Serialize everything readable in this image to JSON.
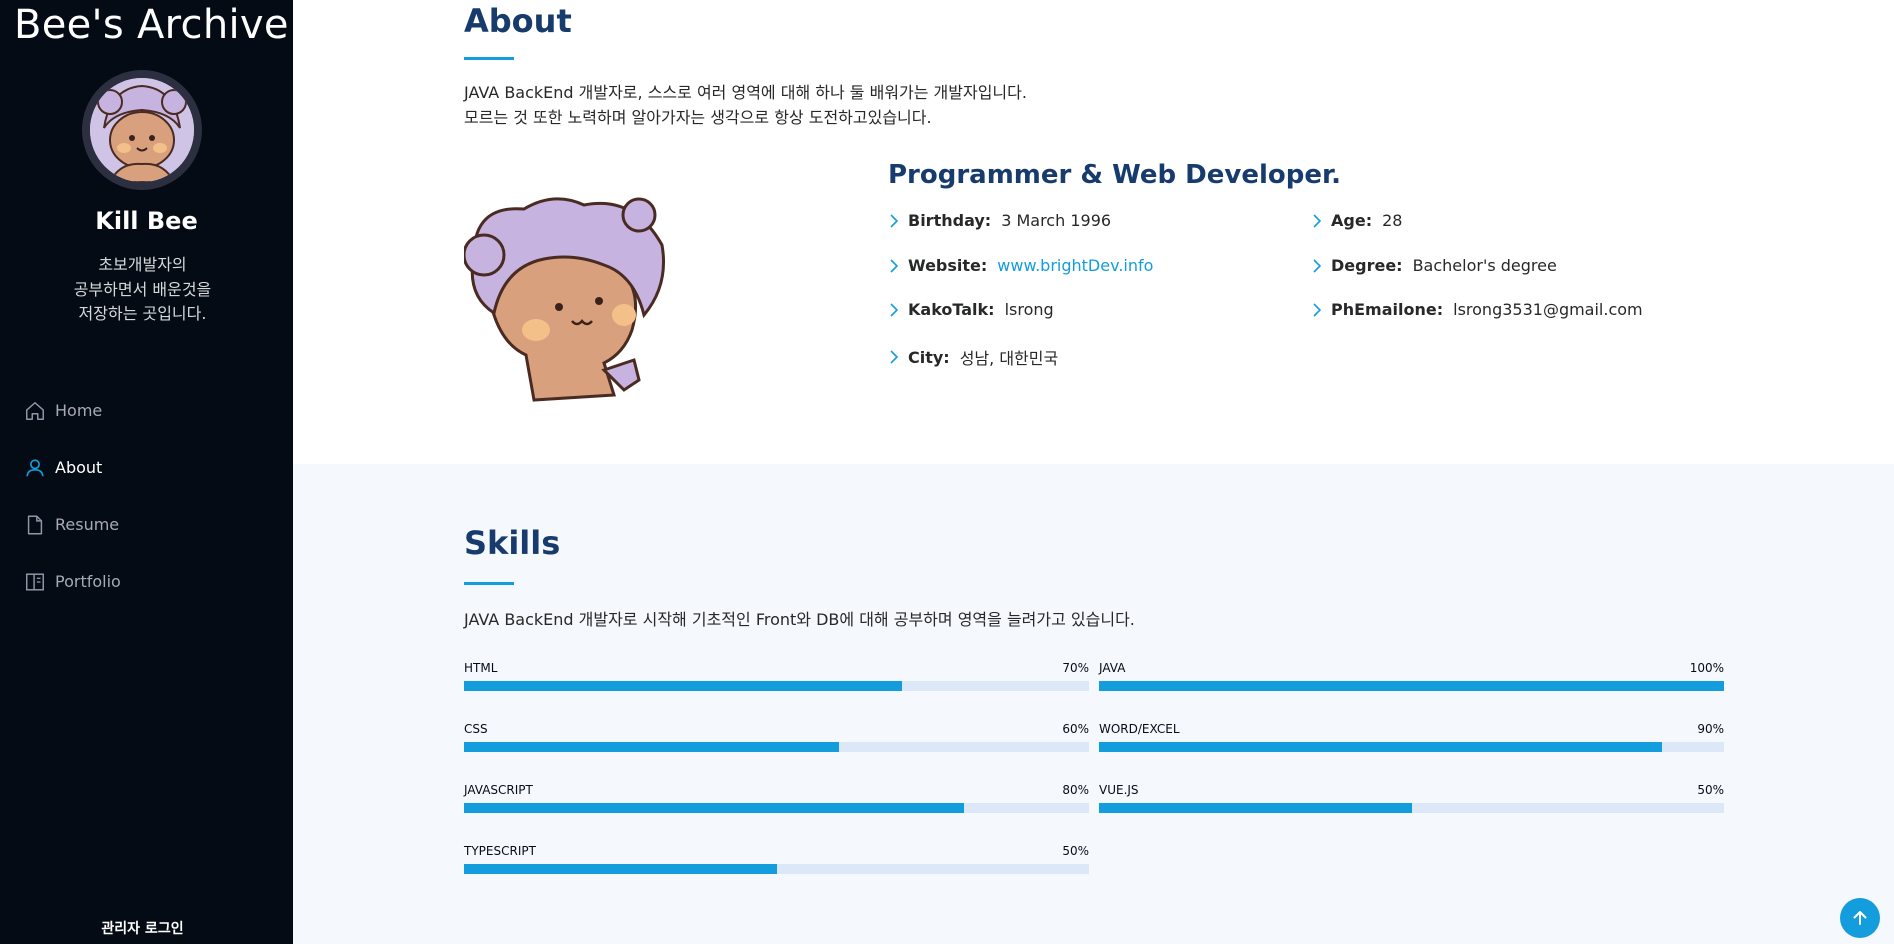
{
  "sidebar": {
    "site_title": "Bee's Archive",
    "profile_name": "Kill Bee",
    "profile_desc": "초보개발자의\n공부하면서 배운것을\n저장하는 곳입니다.",
    "nav": [
      {
        "label": "Home",
        "icon": "home-icon",
        "active": false
      },
      {
        "label": "About",
        "icon": "person-icon",
        "active": true
      },
      {
        "label": "Resume",
        "icon": "file-icon",
        "active": false
      },
      {
        "label": "Portfolio",
        "icon": "book-icon",
        "active": false
      }
    ],
    "admin_login": "관리자 로그인"
  },
  "about": {
    "title": "About",
    "desc": "JAVA BackEnd 개발자로, 스스로 여러 영역에 대해 하나 둘 배워가는 개발자입니다.\n모르는 것 또한 노력하며 알아가자는 생각으로 항상 도전하고있습니다.",
    "heading": "Programmer & Web Developer.",
    "info": {
      "birthday": {
        "label": "Birthday:",
        "value": "3 March 1996"
      },
      "website": {
        "label": "Website:",
        "value": "www.brightDev.info"
      },
      "kakaotalk": {
        "label": "KakoTalk:",
        "value": "lsrong"
      },
      "city": {
        "label": "City:",
        "value": "성남, 대한민국"
      },
      "age": {
        "label": "Age:",
        "value": "28"
      },
      "degree": {
        "label": "Degree:",
        "value": "Bachelor's degree"
      },
      "email": {
        "label": "PhEmailone:",
        "value": "lsrong3531@gmail.com"
      }
    }
  },
  "skills": {
    "title": "Skills",
    "desc": "JAVA BackEnd 개발자로 시작해 기초적인 Front와 DB에 대해 공부하며 영역을 늘려가고 있습니다.",
    "items": [
      {
        "name": "HTML",
        "value": 70,
        "label": "70%"
      },
      {
        "name": "JAVA",
        "value": 100,
        "label": "100%"
      },
      {
        "name": "CSS",
        "value": 60,
        "label": "60%"
      },
      {
        "name": "WORD/EXCEL",
        "value": 90,
        "label": "90%"
      },
      {
        "name": "JAVASCRIPT",
        "value": 80,
        "label": "80%"
      },
      {
        "name": "VUE.JS",
        "value": 50,
        "label": "50%"
      },
      {
        "name": "TYPESCRIPT",
        "value": 50,
        "label": "50%"
      }
    ]
  },
  "colors": {
    "accent": "#149ddd",
    "sidebar_bg": "#040b14",
    "heading": "#173b6c",
    "skills_bg": "#f5f8fd",
    "track": "#dce8f8"
  }
}
